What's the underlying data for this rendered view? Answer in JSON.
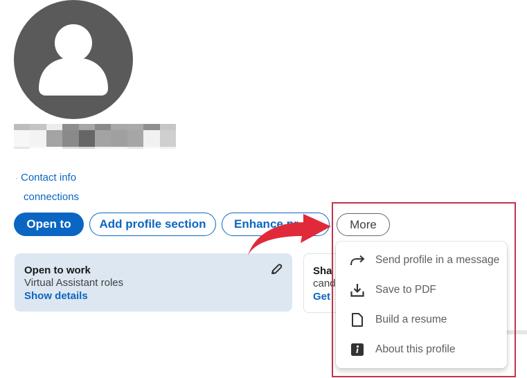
{
  "profile": {
    "avatar_icon": "person-silhouette-icon",
    "name_redacted": true,
    "contact_info_label": "Contact info",
    "connections_label": "connections"
  },
  "actions": {
    "open_to_label": "Open to",
    "add_profile_section_label": "Add profile section",
    "enhance_profile_label": "Enhance pr",
    "more_label": "More"
  },
  "open_to_work_card": {
    "title": "Open to work",
    "subtitle": "Virtual Assistant roles",
    "link": "Show details",
    "edit_icon": "pencil-icon"
  },
  "share_card": {
    "title": "Sha",
    "subtitle": "cand",
    "link": "Get"
  },
  "more_menu": {
    "items": [
      {
        "label": "Send profile in a message",
        "icon": "share-arrow-icon"
      },
      {
        "label": "Save to PDF",
        "icon": "download-icon"
      },
      {
        "label": "Build a resume",
        "icon": "document-icon"
      },
      {
        "label": "About this profile",
        "icon": "info-icon"
      }
    ]
  },
  "annotation": {
    "highlight_color": "#c0334b",
    "arrow_color": "#e02a3a"
  },
  "colors": {
    "brand_blue": "#0a66c2",
    "avatar_gray": "#5a5a5a",
    "card_bg": "#dde7f1"
  }
}
